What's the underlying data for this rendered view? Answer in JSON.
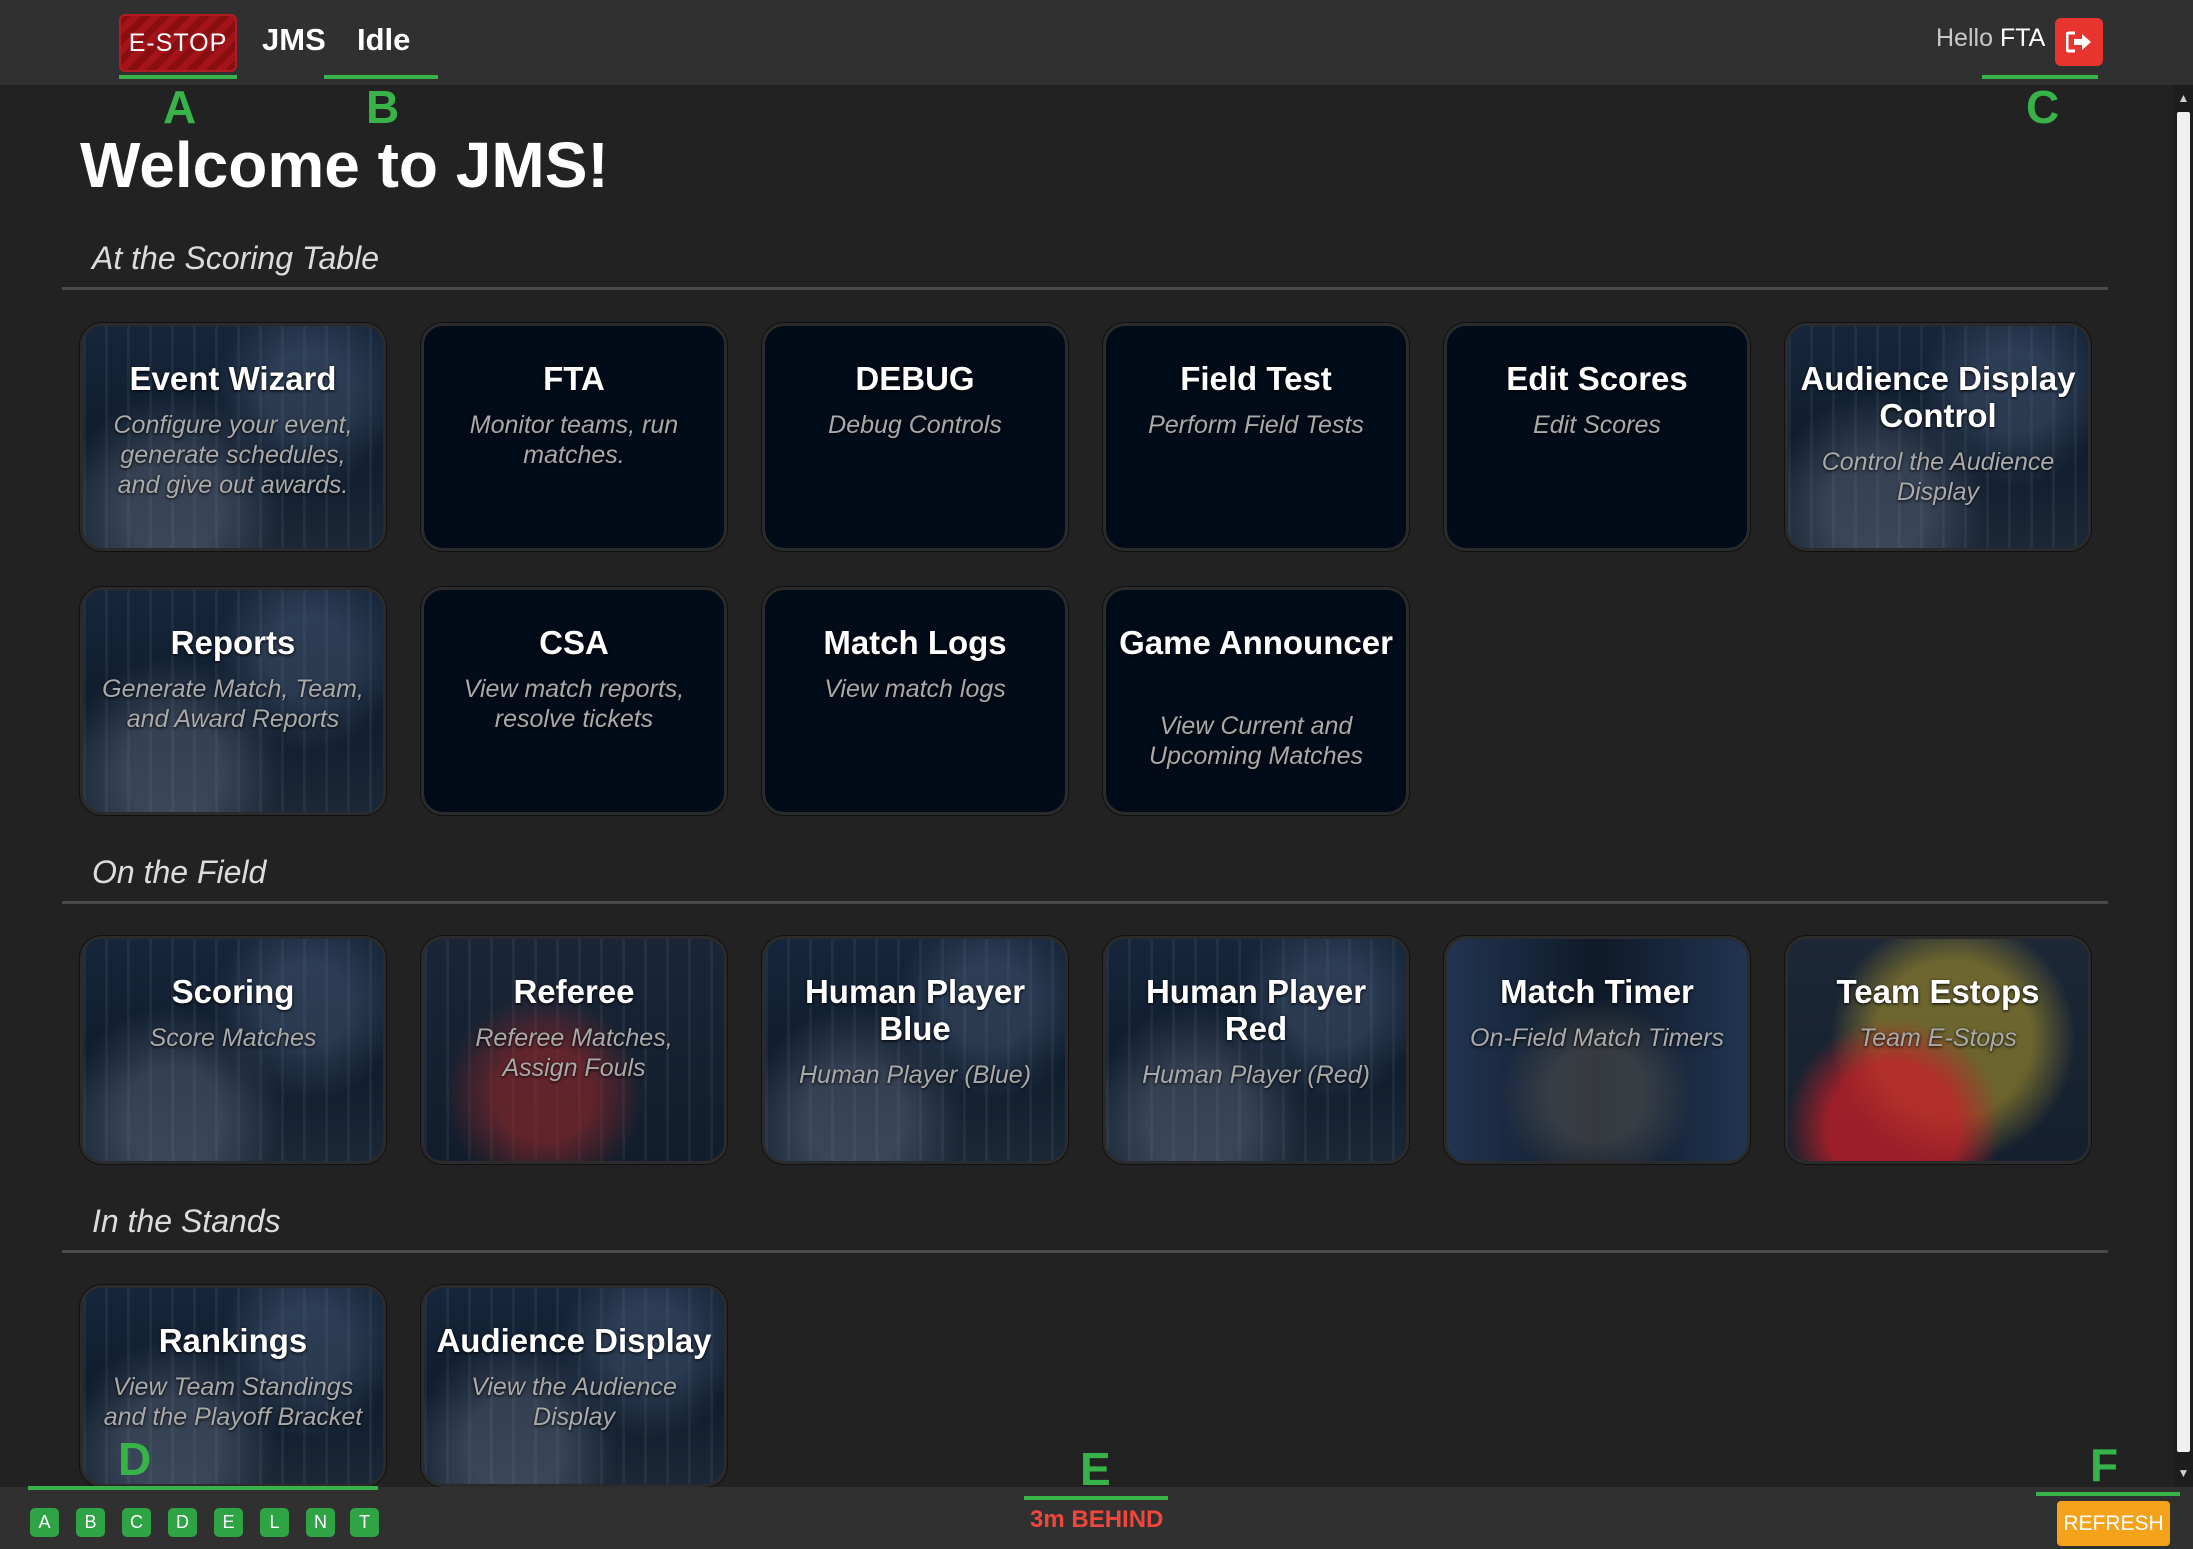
{
  "header": {
    "estop_label": "E-STOP",
    "brand": "JMS",
    "status": "Idle",
    "greeting": "Hello",
    "username": "FTA",
    "logout_icon": "sign-out-icon"
  },
  "annotations": [
    "A",
    "B",
    "C",
    "D",
    "E",
    "F"
  ],
  "page_title": "Welcome to JMS!",
  "sections": [
    {
      "title": "At the Scoring Table",
      "cards": [
        {
          "title": "Event Wizard",
          "subtitle": "Configure your event, generate schedules, and give out awards."
        },
        {
          "title": "FTA",
          "subtitle": "Monitor teams, run matches."
        },
        {
          "title": "DEBUG",
          "subtitle": "Debug Controls"
        },
        {
          "title": "Field Test",
          "subtitle": "Perform Field Tests"
        },
        {
          "title": "Edit Scores",
          "subtitle": "Edit Scores"
        },
        {
          "title": "Audience Display Control",
          "subtitle": "Control the Audience Display"
        },
        {
          "title": "Reports",
          "subtitle": "Generate Match, Team, and Award Reports"
        },
        {
          "title": "CSA",
          "subtitle": "View match reports, resolve tickets"
        },
        {
          "title": "Match Logs",
          "subtitle": "View match logs"
        },
        {
          "title": "Game Announcer",
          "subtitle": "View Current and Upcoming Matches"
        }
      ]
    },
    {
      "title": "On the Field",
      "cards": [
        {
          "title": "Scoring",
          "subtitle": "Score Matches"
        },
        {
          "title": "Referee",
          "subtitle": "Referee Matches, Assign Fouls"
        },
        {
          "title": "Human Player Blue",
          "subtitle": "Human Player (Blue)"
        },
        {
          "title": "Human Player Red",
          "subtitle": "Human Player (Red)"
        },
        {
          "title": "Match Timer",
          "subtitle": "On-Field Match Timers"
        },
        {
          "title": "Team Estops",
          "subtitle": "Team E-Stops"
        }
      ]
    },
    {
      "title": "In the Stands",
      "cards": [
        {
          "title": "Rankings",
          "subtitle": "View Team Standings and the Playoff Bracket"
        },
        {
          "title": "Audience Display",
          "subtitle": "View the Audience Display"
        }
      ]
    }
  ],
  "footer": {
    "nodes": [
      "A",
      "B",
      "C",
      "D",
      "E",
      "L",
      "N",
      "T"
    ],
    "schedule_status": "3m BEHIND",
    "refresh_label": "REFRESH"
  },
  "colors": {
    "background": "#222222",
    "bar": "#303030",
    "card": "#020b18",
    "estop": "#a3141a",
    "logout": "#e8342f",
    "node_ok": "#2fa445",
    "behind": "#f0473d",
    "refresh": "#f3a21a",
    "annotation": "#37b34a"
  }
}
